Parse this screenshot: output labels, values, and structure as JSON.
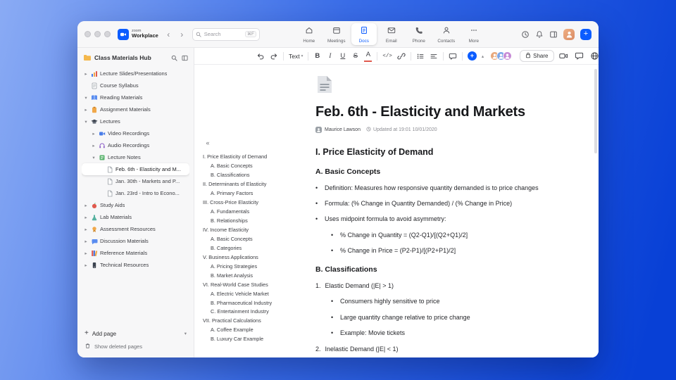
{
  "titlebar": {
    "logo_small": "zoom",
    "logo_name": "Workplace",
    "search_placeholder": "Search",
    "search_shortcut": "⌘F"
  },
  "tabs": [
    {
      "label": "Home"
    },
    {
      "label": "Meetings"
    },
    {
      "label": "Docs"
    },
    {
      "label": "Email"
    },
    {
      "label": "Phone"
    },
    {
      "label": "Contacts"
    },
    {
      "label": "More"
    }
  ],
  "sidebar": {
    "title": "Class Materials Hub",
    "tree": [
      {
        "label": "Lecture Slides/Presentations",
        "icon": "chart",
        "indent": 0,
        "chevron": "right",
        "selected": false
      },
      {
        "label": "Course Syllabus",
        "icon": "page",
        "indent": 0,
        "chevron": "none",
        "selected": false
      },
      {
        "label": "Reading Materials",
        "icon": "book",
        "indent": 0,
        "chevron": "down",
        "selected": false
      },
      {
        "label": "Assignment Materials",
        "icon": "clipboard",
        "indent": 0,
        "chevron": "right",
        "selected": false
      },
      {
        "label": "Lectures",
        "icon": "cap",
        "indent": 0,
        "chevron": "down",
        "selected": false
      },
      {
        "label": "Video Recordings",
        "icon": "video",
        "indent": 1,
        "chevron": "right",
        "selected": false
      },
      {
        "label": "Audio Recordings",
        "icon": "audio",
        "indent": 1,
        "chevron": "right",
        "selected": false
      },
      {
        "label": "Lecture Notes",
        "icon": "note",
        "indent": 1,
        "chevron": "down",
        "selected": false
      },
      {
        "label": "Feb. 6th - Elasticity and M...",
        "icon": "doc",
        "indent": 2,
        "chevron": "none",
        "selected": true
      },
      {
        "label": "Jan. 30th - Markets and P...",
        "icon": "doc",
        "indent": 2,
        "chevron": "none",
        "selected": false
      },
      {
        "label": "Jan. 23rd - Intro to Econo...",
        "icon": "doc",
        "indent": 2,
        "chevron": "none",
        "selected": false
      },
      {
        "label": "Study Aids",
        "icon": "apple",
        "indent": 0,
        "chevron": "right",
        "selected": false
      },
      {
        "label": "Lab Materials",
        "icon": "flask",
        "indent": 0,
        "chevron": "right",
        "selected": false
      },
      {
        "label": "Assessment Resources",
        "icon": "badge",
        "indent": 0,
        "chevron": "right",
        "selected": false
      },
      {
        "label": "Discussion Materials",
        "icon": "chat",
        "indent": 0,
        "chevron": "right",
        "selected": false
      },
      {
        "label": "Reference Materials",
        "icon": "books",
        "indent": 0,
        "chevron": "right",
        "selected": false
      },
      {
        "label": "Technical Resources",
        "icon": "device",
        "indent": 0,
        "chevron": "right",
        "selected": false
      }
    ],
    "add_page_label": "Add page",
    "show_deleted_label": "Show deleted pages"
  },
  "toolbar": {
    "text_style_label": "Text",
    "bold": "B",
    "italic": "I",
    "underline": "U",
    "strikethrough": "S",
    "text_color": "A",
    "code": "</>",
    "share_label": "Share",
    "accent_color": "#0b5cff"
  },
  "doc": {
    "title": "Feb. 6th - Elasticity and Markets",
    "author": "Maurice Lawson",
    "updated": "Updated at 19:01 10/01/2020",
    "outline": [
      {
        "text": "I. Price Elasticity of Demand",
        "level": 0
      },
      {
        "text": "A. Basic Concepts",
        "level": 1
      },
      {
        "text": "B. Classifications",
        "level": 1
      },
      {
        "text": "II. Determinants of Elasticity",
        "level": 0
      },
      {
        "text": "A. Primary Factors",
        "level": 1
      },
      {
        "text": "III. Cross-Price Elasticity",
        "level": 0
      },
      {
        "text": "A. Fundamentals",
        "level": 1
      },
      {
        "text": "B. Relationships",
        "level": 1
      },
      {
        "text": "IV. Income Elasticity",
        "level": 0
      },
      {
        "text": "A. Basic Concepts",
        "level": 1
      },
      {
        "text": "B. Categories",
        "level": 1
      },
      {
        "text": "V. Business Applications",
        "level": 0
      },
      {
        "text": "A. Pricing Strategies",
        "level": 1
      },
      {
        "text": "B. Market Analysis",
        "level": 1
      },
      {
        "text": "VI. Real-World Case Studies",
        "level": 0
      },
      {
        "text": "A. Electric Vehicle Market",
        "level": 1
      },
      {
        "text": "B. Pharmaceutical Industry",
        "level": 1
      },
      {
        "text": "C. Entertainment Industry",
        "level": 1
      },
      {
        "text": "VII. Practical Calculations",
        "level": 0
      },
      {
        "text": "A. Coffee Example",
        "level": 1
      },
      {
        "text": "B. Luxury Car Example",
        "level": 1
      }
    ],
    "body": [
      {
        "type": "h2",
        "text": "I. Price Elasticity of Demand"
      },
      {
        "type": "h3",
        "text": "A. Basic Concepts"
      },
      {
        "type": "bullet",
        "level": 0,
        "text": "Definition: Measures how responsive quantity demanded is to price changes"
      },
      {
        "type": "bullet",
        "level": 0,
        "text": "Formula: (% Change in Quantity Demanded) / (% Change in Price)"
      },
      {
        "type": "bullet",
        "level": 0,
        "text": "Uses midpoint formula to avoid asymmetry:"
      },
      {
        "type": "bullet",
        "level": 1,
        "text": "% Change in Quantity = (Q2-Q1)/[(Q2+Q1)/2]"
      },
      {
        "type": "bullet",
        "level": 1,
        "text": "% Change in Price = (P2-P1)/[(P2+P1)/2]"
      },
      {
        "type": "h3",
        "text": "B. Classifications"
      },
      {
        "type": "number",
        "num": "1.",
        "text": "Elastic Demand (|E| > 1)"
      },
      {
        "type": "bullet",
        "level": 1,
        "text": "Consumers highly sensitive to price"
      },
      {
        "type": "bullet",
        "level": 1,
        "text": "Large quantity change relative to price change"
      },
      {
        "type": "bullet",
        "level": 1,
        "text": "Example: Movie tickets"
      },
      {
        "type": "number",
        "num": "2.",
        "text": "Inelastic Demand (|E| < 1)"
      }
    ]
  }
}
